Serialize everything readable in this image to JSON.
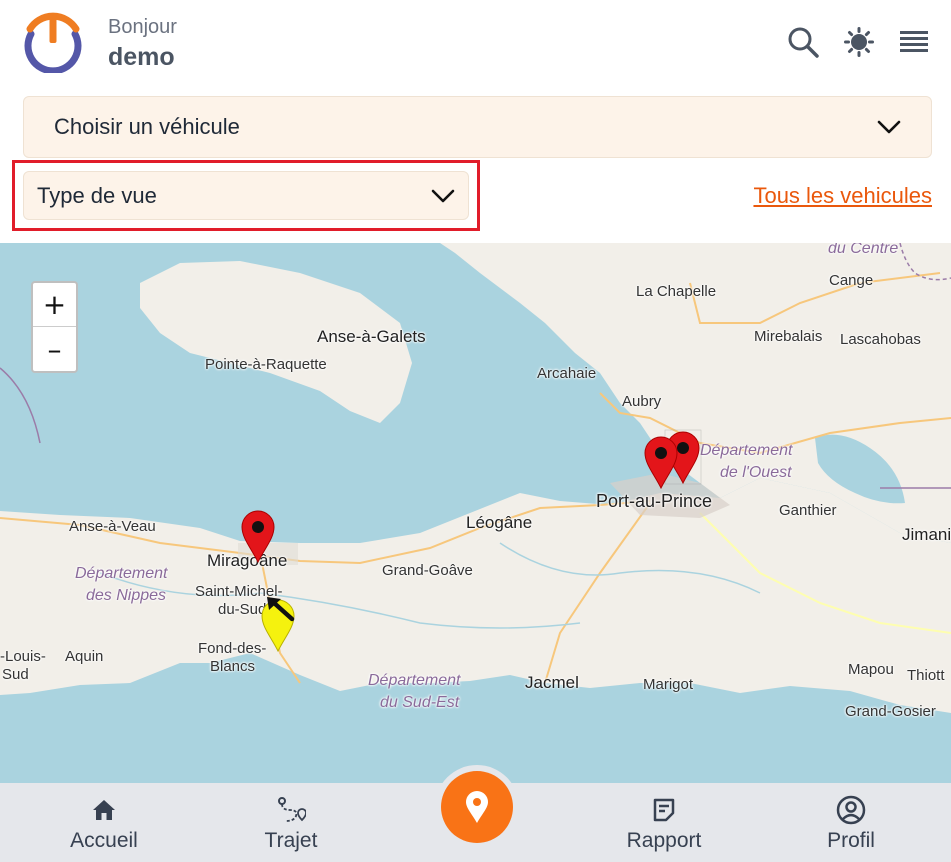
{
  "header": {
    "greeting": "Bonjour",
    "username": "demo",
    "brand_colors": {
      "orange": "#ef7d22",
      "indigo": "#5457a8"
    },
    "icons": [
      "search-icon",
      "theme-icon",
      "menu-icon"
    ]
  },
  "vehicle_select": {
    "label": "Choisir un véhicule",
    "icon": "chevron-down-icon"
  },
  "view_select": {
    "label": "Type de vue",
    "icon": "chevron-down-icon",
    "highlight_color": "#e11d2a"
  },
  "all_vehicles_link": "Tous les vehicules",
  "map": {
    "zoom_in": "+",
    "zoom_out": "–",
    "places": {
      "anse_a_galets": "Anse-à-Galets",
      "pointe_a_raquette": "Pointe-à-Raquette",
      "la_chapelle": "La Chapelle",
      "cange": "Cange",
      "mirebalais": "Mirebalais",
      "lascahobas": "Lascahobas",
      "arcahaie": "Arcahaie",
      "aubry": "Aubry",
      "du_centre": "du Centre",
      "dept_ouest_1": "Département",
      "dept_ouest_2": "de l'Ouest",
      "port_au_prince": "Port-au-Prince",
      "ganthier": "Ganthier",
      "jimani": "Jimani",
      "anse_a_veau": "Anse-à-Veau",
      "miragoane": "Miragoâne",
      "leogane": "Léogâne",
      "grand_goave": "Grand-Goâve",
      "dept_nippes_1": "Département",
      "dept_nippes_2": "des Nippes",
      "saint_michel_1": "Saint-Michel-",
      "saint_michel_2": "du-Sud",
      "fond_des_blancs_1": "Fond-des-",
      "fond_des_blancs_2": "Blancs",
      "louis_1": "-Louis-",
      "louis_2": "Sud",
      "aquin": "Aquin",
      "dept_sud_est_1": "Département",
      "dept_sud_est_2": "du Sud-Est",
      "jacmel": "Jacmel",
      "marigot": "Marigot",
      "mapou": "Mapou",
      "thiotte": "Thiott",
      "grand_gosier": "Grand-Gosier"
    },
    "markers": [
      {
        "type": "red-pin",
        "place": "Port-au-Prince"
      },
      {
        "type": "red-pin",
        "place": "Port-au-Prince"
      },
      {
        "type": "red-pin",
        "place": "Miragoâne"
      },
      {
        "type": "yellow-pin-arrow",
        "place": "Saint-Michel-du-Sud"
      }
    ]
  },
  "bottom_nav": {
    "items": [
      {
        "label": "Accueil",
        "icon": "home-icon"
      },
      {
        "label": "Trajet",
        "icon": "route-icon"
      },
      {
        "label": "Rapport",
        "icon": "report-icon"
      },
      {
        "label": "Profil",
        "icon": "profile-icon"
      }
    ],
    "fab_icon": "location-pin-icon",
    "fab_color": "#f97316"
  }
}
